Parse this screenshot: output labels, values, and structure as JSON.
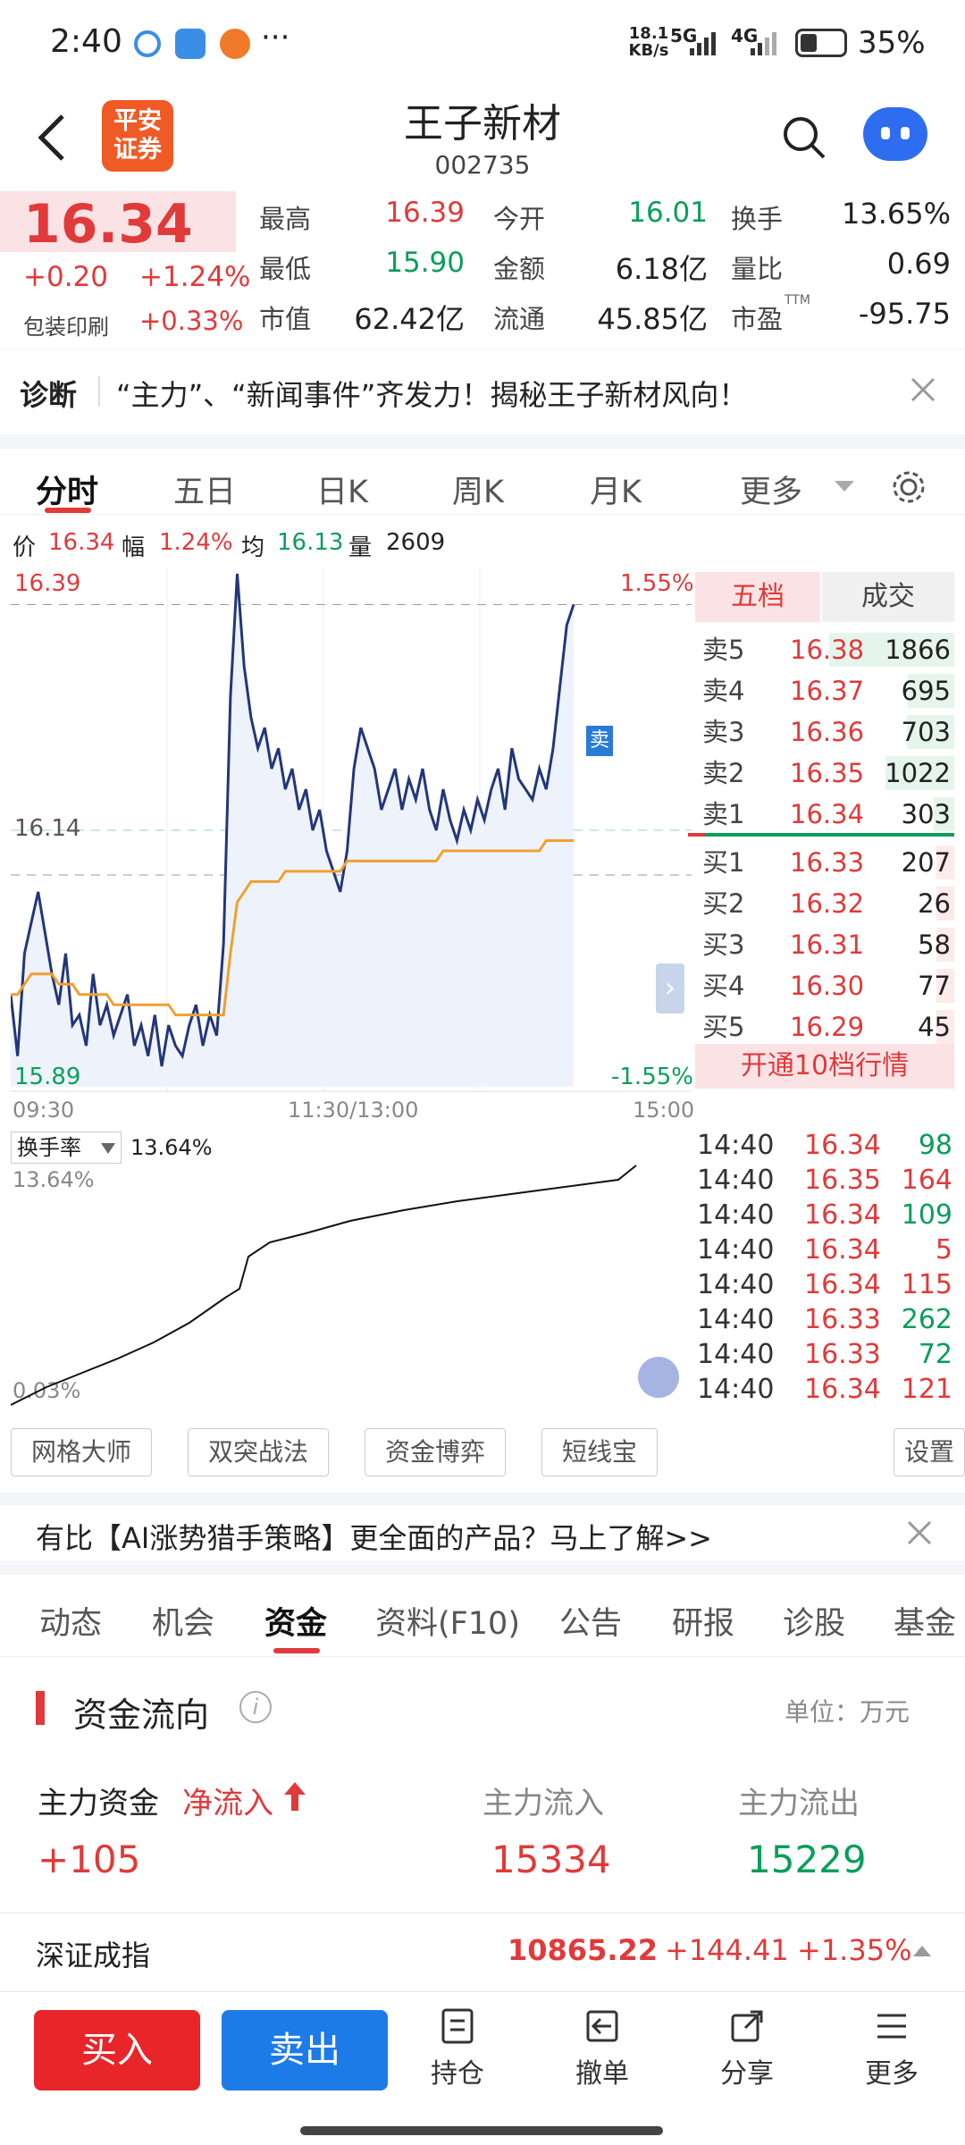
{
  "status": {
    "time": "2:40",
    "dots": "···",
    "net_speed_1": "18.1",
    "net_speed_2": "KB/s",
    "sig1": "5G",
    "sig2": "4G",
    "battery": "35%"
  },
  "header": {
    "title": "王子新材",
    "code": "002735",
    "logo_line1": "平安",
    "logo_line2": "证券"
  },
  "quote": {
    "price": "16.34",
    "change": "+0.20",
    "change_pct": "+1.24%",
    "sector": "包装印刷",
    "sector_pct": "+0.33%",
    "fields": [
      {
        "label": "最高",
        "value": "16.39",
        "color": "red"
      },
      {
        "label": "今开",
        "value": "16.01",
        "color": "green"
      },
      {
        "label": "换手",
        "value": "13.65%",
        "color": "dark"
      },
      {
        "label": "最低",
        "value": "15.90",
        "color": "green"
      },
      {
        "label": "金额",
        "value": "6.18亿",
        "color": "dark"
      },
      {
        "label": "量比",
        "value": "0.69",
        "color": "dark"
      },
      {
        "label": "市值",
        "value": "62.42亿",
        "color": "dark"
      },
      {
        "label": "流通",
        "value": "45.85亿",
        "color": "dark"
      },
      {
        "label": "市盈",
        "value": "-95.75",
        "color": "dark"
      }
    ],
    "pe_sup": "TTM"
  },
  "diag": {
    "label": "诊断",
    "text": "“主力”、“新闻事件”齐发力！揭秘王子新材风向！"
  },
  "tabs": [
    "分时",
    "五日",
    "日K",
    "周K",
    "月K",
    "更多"
  ],
  "chart_info": {
    "price_label": "价",
    "price": "16.34",
    "amp_label": "幅",
    "amp": "1.24%",
    "avg_label": "均",
    "avg": "16.13",
    "vol_label": "量",
    "vol": "2609"
  },
  "chart_data": {
    "type": "line",
    "title": "",
    "ymax_label": "16.39",
    "ymid_label": "16.14",
    "ymin_label": "15.89",
    "pct_max": "1.55%",
    "pct_min": "-1.55%",
    "x_labels": [
      "09:30",
      "11:30/13:00",
      "15:00"
    ],
    "sell_marker": "卖",
    "ylim": [
      15.89,
      16.39
    ],
    "price": [
      15.98,
      15.92,
      16.02,
      16.05,
      16.08,
      16.04,
      16.0,
      15.97,
      16.02,
      15.95,
      15.96,
      15.93,
      16.0,
      15.95,
      15.97,
      15.94,
      15.96,
      15.98,
      15.93,
      15.95,
      15.92,
      15.96,
      15.91,
      15.95,
      15.93,
      15.92,
      15.95,
      15.97,
      15.93,
      15.96,
      15.94,
      16.03,
      16.27,
      16.39,
      16.3,
      16.25,
      16.22,
      16.24,
      16.2,
      16.22,
      16.18,
      16.2,
      16.16,
      16.18,
      16.14,
      16.16,
      16.12,
      16.1,
      16.08,
      16.12,
      16.2,
      16.24,
      16.22,
      16.2,
      16.16,
      16.18,
      16.2,
      16.16,
      16.19,
      16.17,
      16.2,
      16.16,
      16.14,
      16.18,
      16.15,
      16.13,
      16.16,
      16.14,
      16.17,
      16.15,
      16.18,
      16.2,
      16.16,
      16.22,
      16.19,
      16.18,
      16.17,
      16.2,
      16.18,
      16.22,
      16.28,
      16.34,
      16.36
    ],
    "avg": [
      15.98,
      15.98,
      15.99,
      16.0,
      16.0,
      16.0,
      16.0,
      15.99,
      15.99,
      15.99,
      15.98,
      15.98,
      15.98,
      15.98,
      15.98,
      15.97,
      15.97,
      15.97,
      15.97,
      15.97,
      15.97,
      15.97,
      15.97,
      15.97,
      15.96,
      15.96,
      15.96,
      15.96,
      15.96,
      15.96,
      15.96,
      15.96,
      16.02,
      16.07,
      16.08,
      16.09,
      16.09,
      16.09,
      16.09,
      16.09,
      16.1,
      16.1,
      16.1,
      16.1,
      16.1,
      16.1,
      16.1,
      16.1,
      16.1,
      16.11,
      16.11,
      16.11,
      16.11,
      16.11,
      16.11,
      16.11,
      16.11,
      16.11,
      16.11,
      16.11,
      16.11,
      16.11,
      16.11,
      16.12,
      16.12,
      16.12,
      16.12,
      16.12,
      16.12,
      16.12,
      16.12,
      16.12,
      16.12,
      16.12,
      16.12,
      16.12,
      16.12,
      16.12,
      16.13,
      16.13,
      16.13,
      16.13,
      16.13
    ]
  },
  "orderbook": {
    "tab_active": "五档",
    "tab_other": "成交",
    "sells": [
      {
        "label": "卖5",
        "price": "16.38",
        "vol": "1866"
      },
      {
        "label": "卖4",
        "price": "16.37",
        "vol": "695"
      },
      {
        "label": "卖3",
        "price": "16.36",
        "vol": "703"
      },
      {
        "label": "卖2",
        "price": "16.35",
        "vol": "1022"
      },
      {
        "label": "卖1",
        "price": "16.34",
        "vol": "303"
      }
    ],
    "buys": [
      {
        "label": "买1",
        "price": "16.33",
        "vol": "207"
      },
      {
        "label": "买2",
        "price": "16.32",
        "vol": "26"
      },
      {
        "label": "买3",
        "price": "16.31",
        "vol": "58"
      },
      {
        "label": "买4",
        "price": "16.30",
        "vol": "77"
      },
      {
        "label": "买5",
        "price": "16.29",
        "vol": "45"
      }
    ],
    "upgrade": "开通10档行情"
  },
  "turnover": {
    "selector": "换手率",
    "value": "13.64%",
    "top": "13.64%",
    "bottom": "0.03%"
  },
  "ticks": [
    {
      "t": "14:40",
      "p": "16.34",
      "v": "98",
      "vc": "green"
    },
    {
      "t": "14:40",
      "p": "16.35",
      "v": "164",
      "vc": "red"
    },
    {
      "t": "14:40",
      "p": "16.34",
      "v": "109",
      "vc": "green"
    },
    {
      "t": "14:40",
      "p": "16.34",
      "v": "5",
      "vc": "red"
    },
    {
      "t": "14:40",
      "p": "16.34",
      "v": "115",
      "vc": "red"
    },
    {
      "t": "14:40",
      "p": "16.33",
      "v": "262",
      "vc": "green"
    },
    {
      "t": "14:40",
      "p": "16.33",
      "v": "72",
      "vc": "green"
    },
    {
      "t": "14:40",
      "p": "16.34",
      "v": "121",
      "vc": "red"
    }
  ],
  "tools": [
    "网格大师",
    "双突战法",
    "资金博弈",
    "短线宝",
    "设置"
  ],
  "ad": "有比【AI涨势猎手策略】更全面的产品？马上了解>>",
  "subtabs": [
    "动态",
    "机会",
    "资金",
    "资料(F10)",
    "公告",
    "研报",
    "诊股",
    "基金"
  ],
  "funds": {
    "title": "资金流向",
    "unit": "单位：万元",
    "main_label": "主力资金",
    "net_label": "净流入",
    "inflow_label": "主力流入",
    "outflow_label": "主力流出",
    "net": "+105",
    "inflow": "15334",
    "outflow": "15229"
  },
  "index": {
    "name": "深证成指",
    "value": "10865.22",
    "change": "+144.41",
    "pct": "+1.35%"
  },
  "bottom": {
    "buy": "买入",
    "sell": "卖出",
    "items": [
      "持仓",
      "撤单",
      "分享",
      "更多"
    ]
  }
}
